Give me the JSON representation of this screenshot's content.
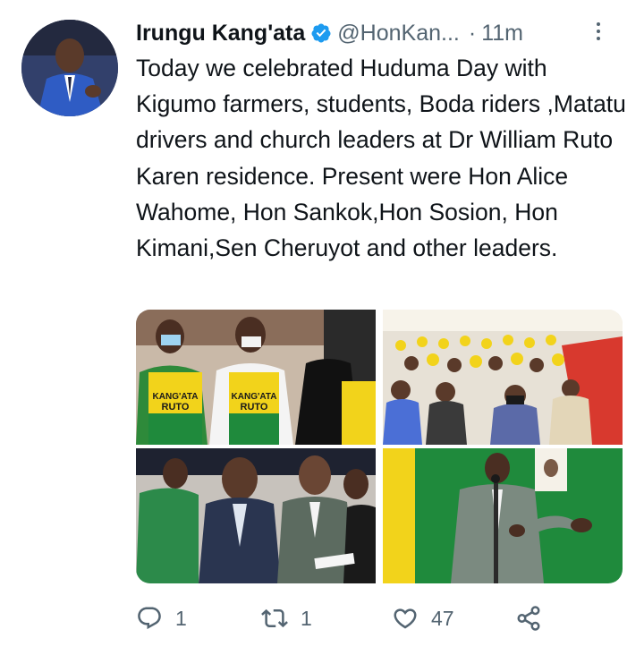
{
  "tweet": {
    "author_name": "Irungu Kang'ata",
    "handle": "@HonKan...",
    "separator": "·",
    "time": "11m",
    "text": "Today we celebrated Huduma Day with Kigumo farmers, students, Boda riders ,Matatu drivers and church leaders at Dr William Ruto Karen residence. Present were Hon Alice Wahome, Hon Sankok,Hon Sosion, Hon Kimani,Sen Cheruyot and other leaders.",
    "photos": [
      {
        "name": "photo-women-in-yellow-aprons",
        "apron_text_1": "KANG'ATA",
        "apron_text_2": "RUTO"
      },
      {
        "name": "photo-seated-crowd"
      },
      {
        "name": "photo-ruto-seated"
      },
      {
        "name": "photo-man-speaking"
      }
    ]
  },
  "actions": {
    "reply_count": "1",
    "retweet_count": "1",
    "like_count": "47"
  },
  "icons": {
    "verified": "verified-badge-icon",
    "more": "more-options-icon",
    "reply": "reply-icon",
    "retweet": "retweet-icon",
    "like": "heart-icon",
    "share": "share-icon"
  },
  "colors": {
    "text": "#0f1419",
    "secondary": "#536471",
    "verified": "#1d9bf0",
    "apron_yellow": "#f2d31b",
    "apron_green": "#1f8a3c"
  }
}
